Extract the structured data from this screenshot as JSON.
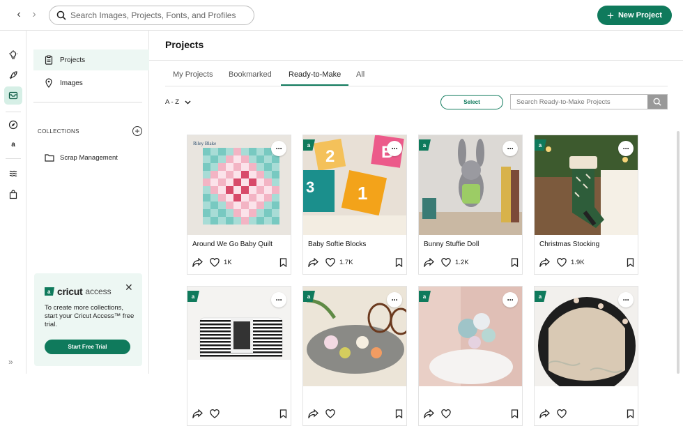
{
  "topbar": {
    "search_placeholder": "Search Images, Projects, Fonts, and Profiles",
    "new_project_label": "New Project"
  },
  "sidebar": {
    "items": [
      {
        "label": "Projects",
        "icon": "clipboard-icon",
        "active": true
      },
      {
        "label": "Images",
        "icon": "image-pin-icon",
        "active": false
      }
    ],
    "collections_label": "COLLECTIONS",
    "folders": [
      {
        "label": "Scrap Management"
      }
    ]
  },
  "access_card": {
    "brand": "cricut",
    "brand_suffix": "access",
    "text": "To create more collections, start your Cricut Access™ free trial.",
    "cta": "Start Free Trial"
  },
  "main": {
    "title": "Projects",
    "tabs": [
      {
        "label": "My Projects"
      },
      {
        "label": "Bookmarked"
      },
      {
        "label": "Ready-to-Make",
        "active": true
      },
      {
        "label": "All"
      }
    ],
    "sort_label": "A - Z",
    "select_label": "Select",
    "search_placeholder": "Search Ready-to-Make Projects"
  },
  "cards": [
    {
      "title": "Around We Go Baby Quilt",
      "likes": "1K",
      "badge": false,
      "thumb": "quilt",
      "brand": "Riley Blake"
    },
    {
      "title": "Baby Softie Blocks",
      "likes": "1.7K",
      "badge": true,
      "thumb": "blocks"
    },
    {
      "title": "Bunny Stuffie Doll",
      "likes": "1.2K",
      "badge": true,
      "thumb": "bunny"
    },
    {
      "title": "Christmas Stocking",
      "likes": "1.9K",
      "badge": true,
      "thumb": "stocking"
    },
    {
      "title": "",
      "likes": "",
      "badge": true,
      "thumb": "bag"
    },
    {
      "title": "",
      "likes": "",
      "badge": true,
      "thumb": "glasses"
    },
    {
      "title": "",
      "likes": "",
      "badge": true,
      "thumb": "flowers"
    },
    {
      "title": "",
      "likes": "",
      "badge": true,
      "thumb": "ball"
    }
  ],
  "colors": {
    "accent": "#0f7a5c",
    "accent_light": "#d6efe6"
  }
}
